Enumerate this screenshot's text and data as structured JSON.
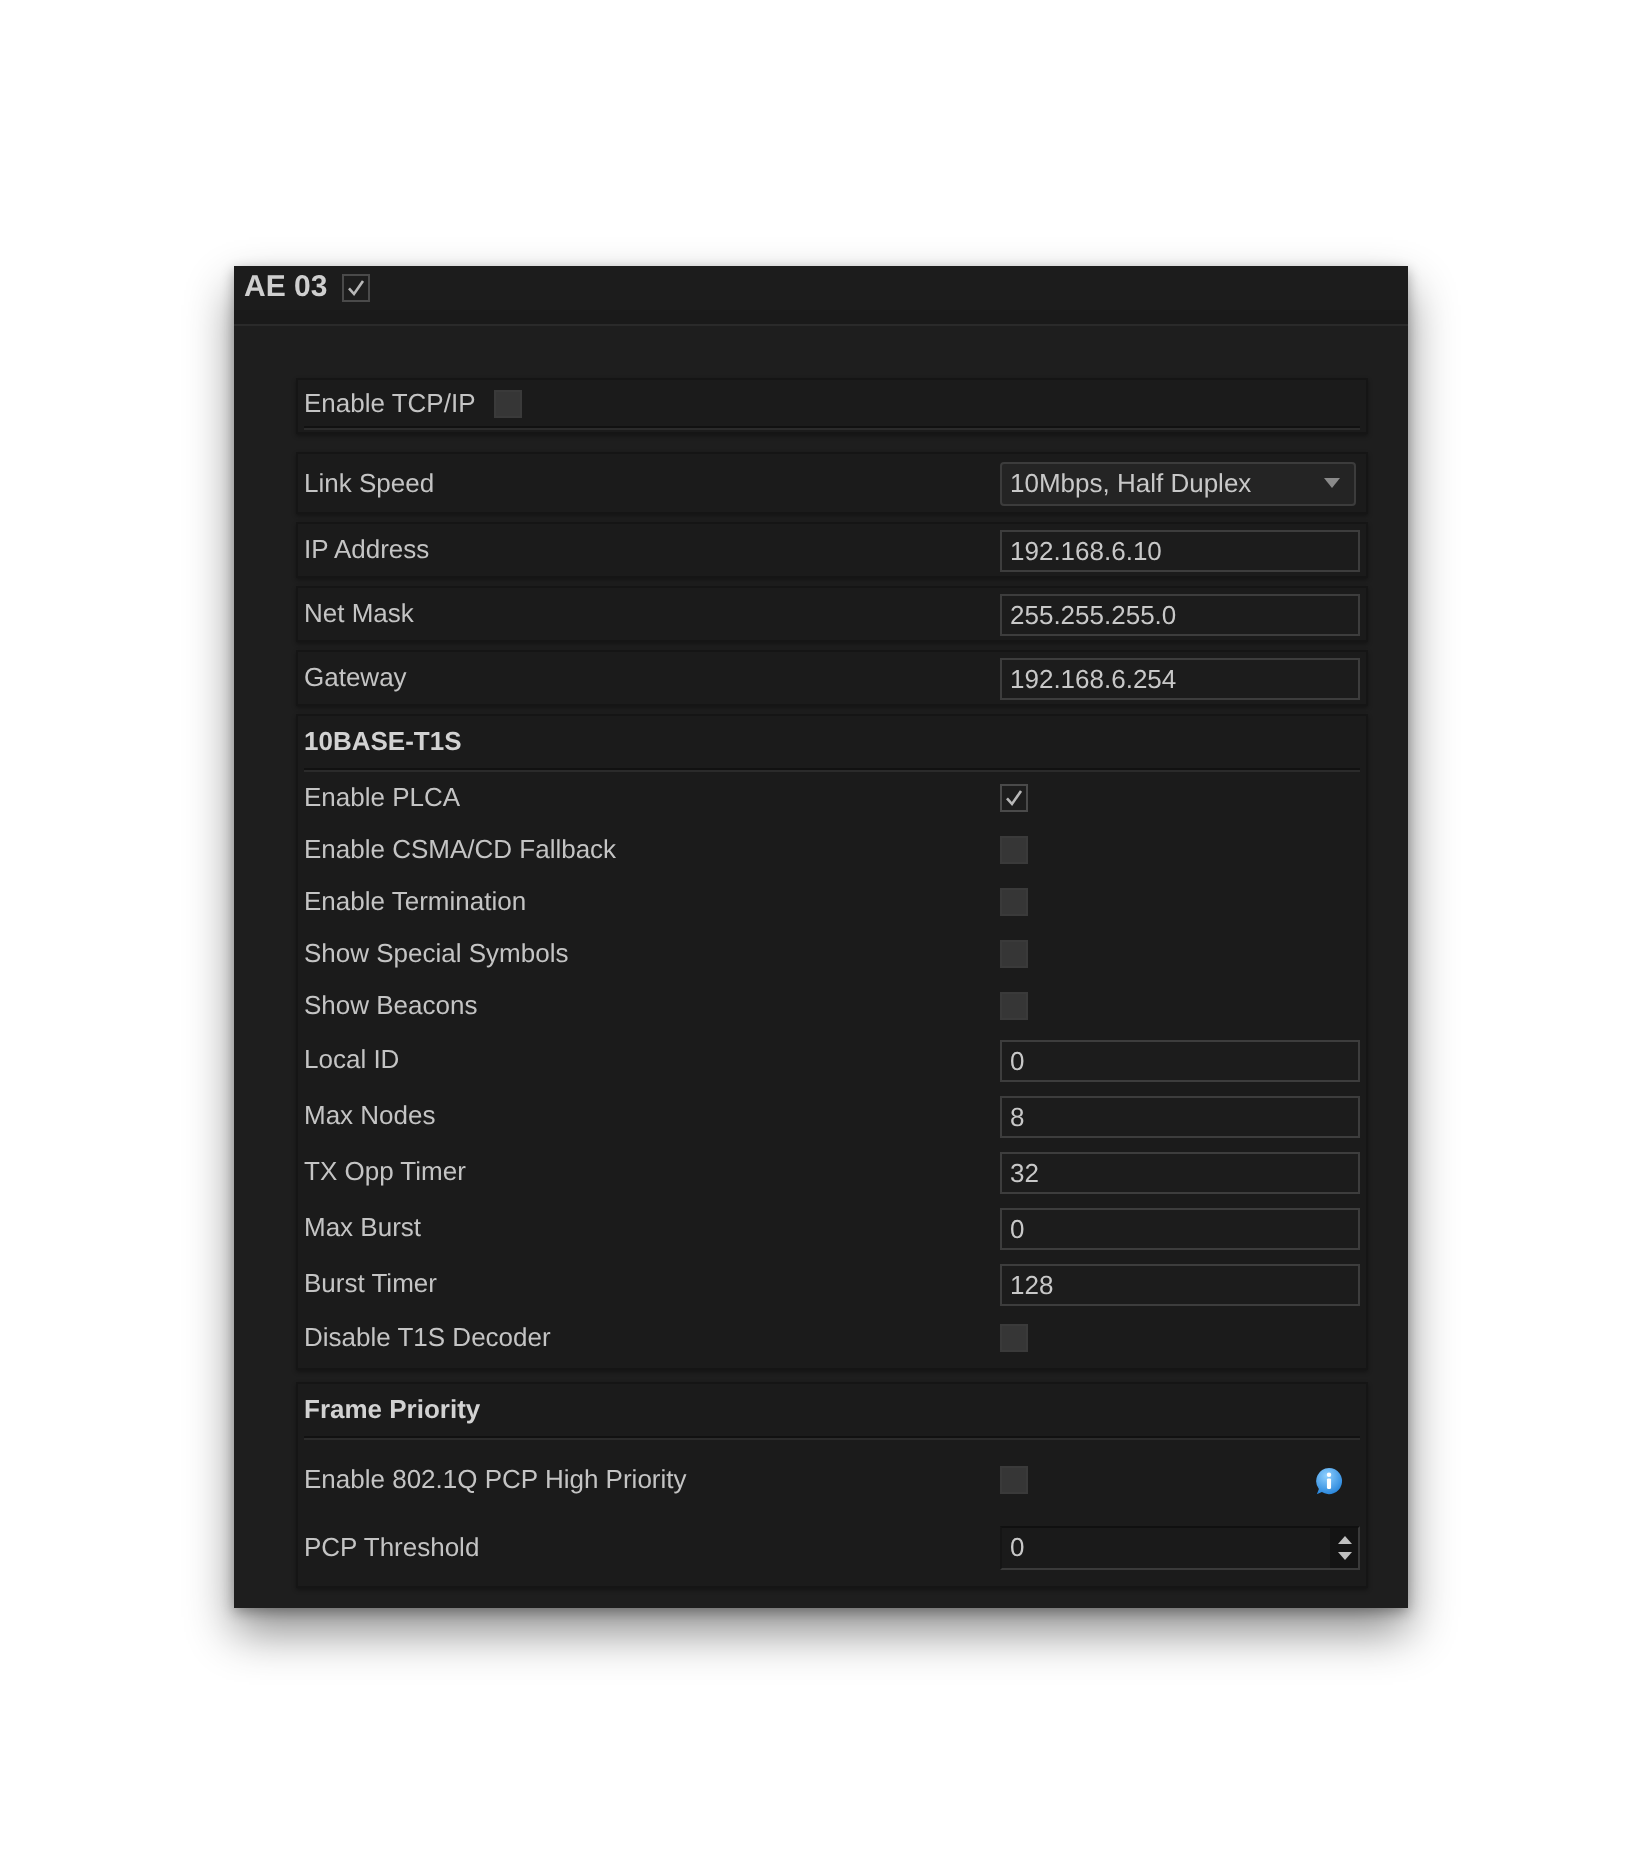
{
  "panel": {
    "title": "AE 03",
    "enabled": true
  },
  "tcp_ip": {
    "label": "Enable TCP/IP",
    "checked": false
  },
  "network": [
    {
      "kind": "dropdown",
      "label": "Link Speed",
      "value": "10Mbps, Half Duplex"
    },
    {
      "kind": "input",
      "label": "IP Address",
      "value": "192.168.6.10"
    },
    {
      "kind": "input",
      "label": "Net Mask",
      "value": "255.255.255.0"
    },
    {
      "kind": "input",
      "label": "Gateway",
      "value": "192.168.6.254"
    }
  ],
  "sections": [
    {
      "title": "10BASE-T1S",
      "rows": [
        {
          "kind": "checkbox",
          "label": "Enable PLCA",
          "checked": true
        },
        {
          "kind": "checkbox",
          "label": "Enable CSMA/CD Fallback",
          "checked": false
        },
        {
          "kind": "checkbox",
          "label": "Enable Termination",
          "checked": false
        },
        {
          "kind": "checkbox",
          "label": "Show Special Symbols",
          "checked": false
        },
        {
          "kind": "checkbox",
          "label": "Show Beacons",
          "checked": false
        },
        {
          "kind": "input",
          "label": "Local ID",
          "value": "0"
        },
        {
          "kind": "input",
          "label": "Max Nodes",
          "value": "8"
        },
        {
          "kind": "input",
          "label": "TX Opp Timer",
          "value": "32"
        },
        {
          "kind": "input",
          "label": "Max Burst",
          "value": "0"
        },
        {
          "kind": "input",
          "label": "Burst Timer",
          "value": "128"
        },
        {
          "kind": "checkbox",
          "label": "Disable T1S Decoder",
          "checked": false
        }
      ]
    },
    {
      "title": "Frame Priority",
      "rows": [
        {
          "kind": "checkbox",
          "label": "Enable 802.1Q PCP High Priority",
          "checked": false,
          "info": true
        },
        {
          "kind": "spinner",
          "label": "PCP Threshold",
          "value": "0"
        }
      ]
    }
  ]
}
